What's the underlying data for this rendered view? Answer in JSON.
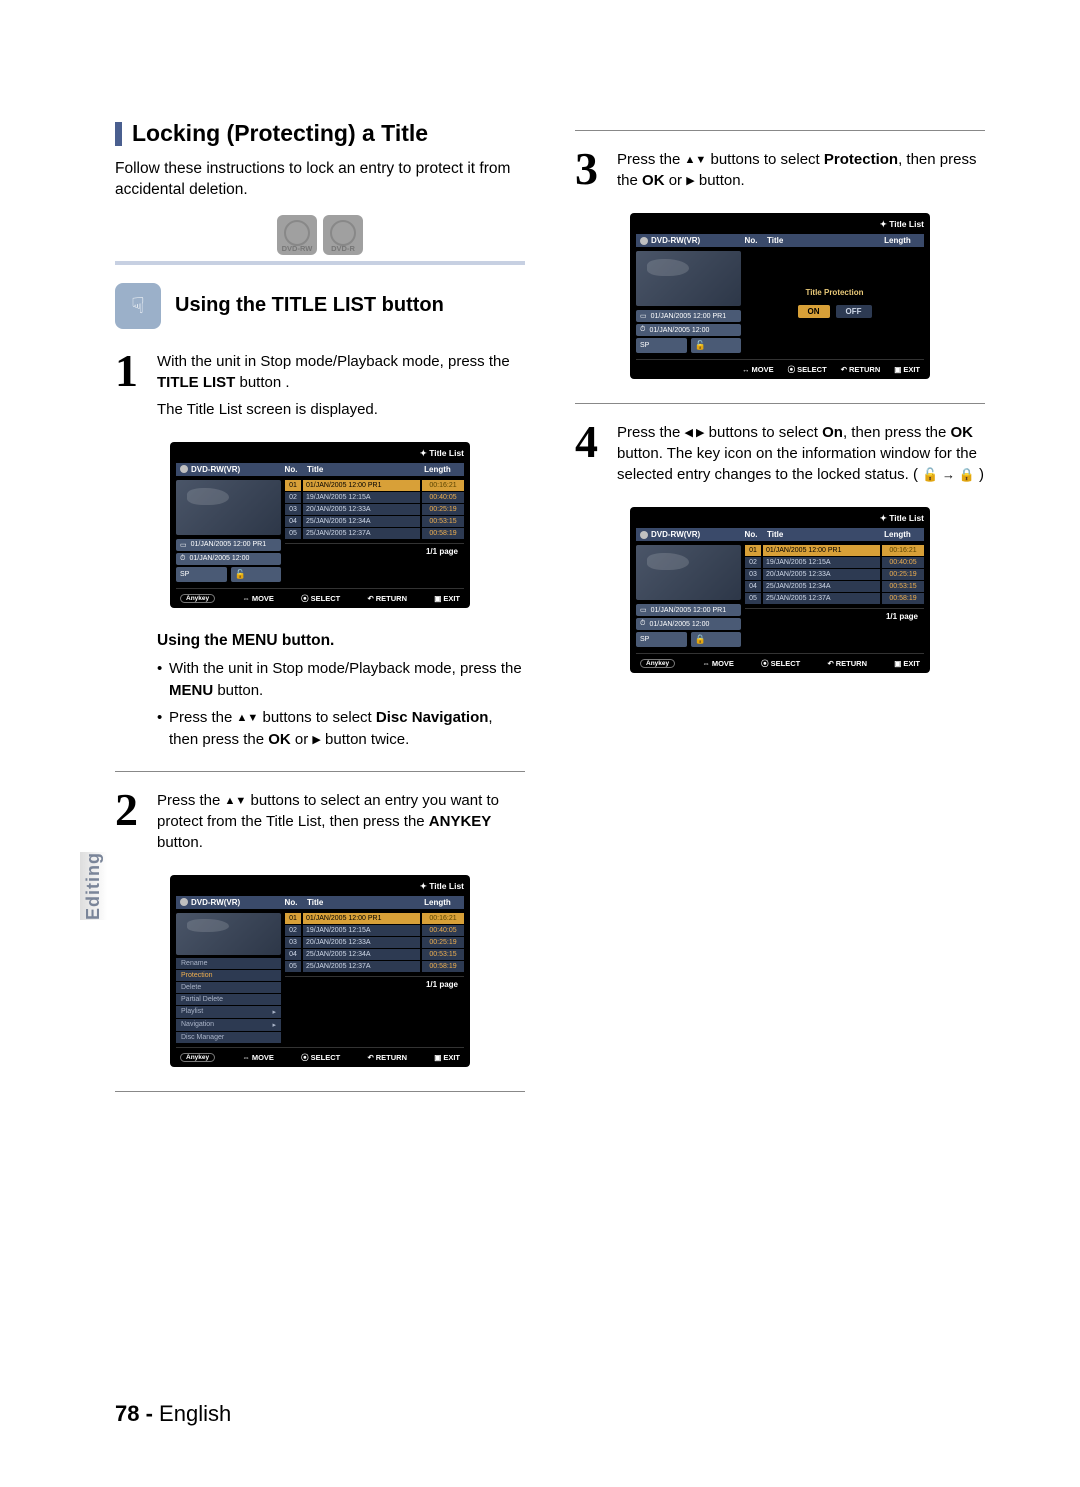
{
  "side_tab": "Editing",
  "page_number": "78 -",
  "page_lang": "English",
  "section_title": "Locking (Protecting) a Title",
  "intro": "Follow these instructions to lock an entry to protect it from accidental deletion.",
  "discs": {
    "rw": "DVD-RW",
    "r": "DVD-R"
  },
  "sub_heading": "Using the TITLE LIST button",
  "steps": {
    "s1a": "With the unit in Stop mode/Playback mode, press the ",
    "s1b": "TITLE LIST",
    "s1c": " button .",
    "s1d": "The Title List screen is displayed.",
    "s2a": "Press the ",
    "s2b": " buttons to select an entry you want to protect from the Title List, then press the ",
    "s2c": "ANYKEY",
    "s2d": " button.",
    "s3a": "Press the ",
    "s3b": " buttons to select ",
    "s3c": "Protection",
    "s3d": ", then press the ",
    "s3e": "OK",
    "s3f": " or ",
    "s3g": " button.",
    "s4a": "Press the ",
    "s4b": " buttons to select ",
    "s4c": "On",
    "s4d": ", then press the ",
    "s4e": "OK",
    "s4f": " button. The key icon on the information window for the selected entry changes to the locked status. ( ",
    "s4g": " )"
  },
  "sub_block": {
    "title": "Using the MENU button.",
    "b1a": "With the unit in Stop mode/Playback mode, press the ",
    "b1b": "MENU",
    "b1c": " button.",
    "b2a": "Press the ",
    "b2b": " buttons to select ",
    "b2c": "Disc Navigation",
    "b2d": ", then press the ",
    "b2e": "OK",
    "b2f": " or ",
    "b2g": " button twice."
  },
  "screen_common": {
    "title": "Title List",
    "dvd": "DVD-RW(VR)",
    "no": "No.",
    "titleh": "Title",
    "lengthh": "Length",
    "page": "1/1 page",
    "move": "MOVE",
    "select": "SELECT",
    "return": "RETURN",
    "exit": "EXIT",
    "anykey": "Anykey",
    "info1": "01/JAN/2005 12:00 PR1",
    "info2": "01/JAN/2005 12:00",
    "sp": "SP"
  },
  "rows": [
    {
      "no": "01",
      "title": "01/JAN/2005 12:00 PR1",
      "len": "00:16:21"
    },
    {
      "no": "02",
      "title": "19/JAN/2005 12:15A",
      "len": "00:40:05"
    },
    {
      "no": "03",
      "title": "20/JAN/2005 12:33A",
      "len": "00:25:19"
    },
    {
      "no": "04",
      "title": "25/JAN/2005 12:34A",
      "len": "00:53:15"
    },
    {
      "no": "05",
      "title": "25/JAN/2005 12:37A",
      "len": "00:58:19"
    }
  ],
  "menu_items": [
    "Rename",
    "Protection",
    "Delete",
    "Partial Delete",
    "Playlist",
    "Navigation",
    "Disc Manager"
  ],
  "protection": {
    "label": "Title Protection",
    "on": "ON",
    "off": "OFF"
  }
}
